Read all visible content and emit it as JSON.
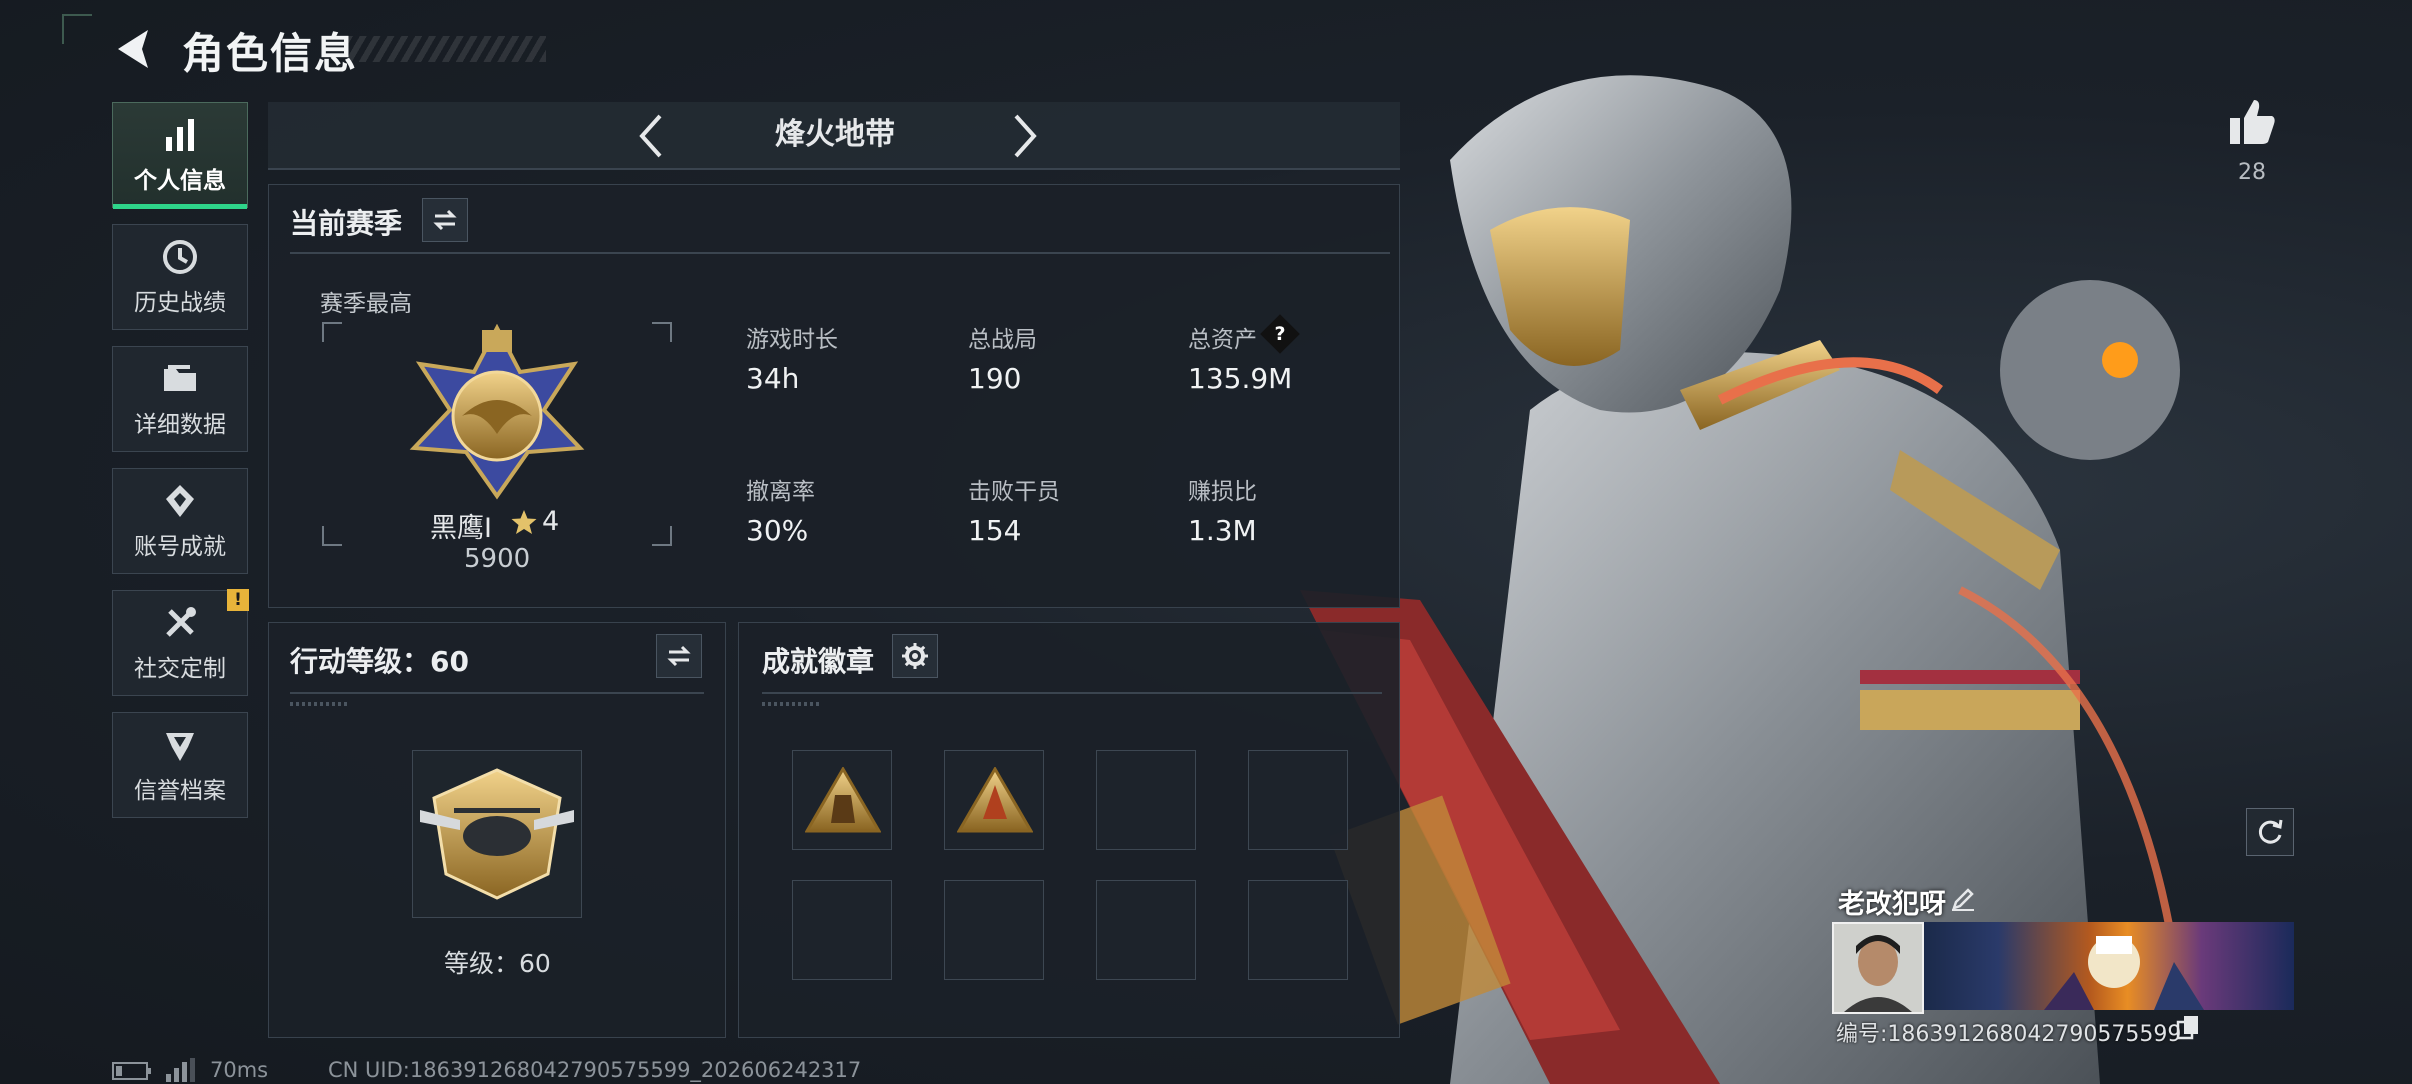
{
  "header": {
    "title": "角色信息"
  },
  "sidebar": {
    "items": [
      {
        "label": "个人信息",
        "icon": "bar-chart-icon",
        "active": true
      },
      {
        "label": "历史战绩",
        "icon": "history-clock-icon",
        "active": false
      },
      {
        "label": "详细数据",
        "icon": "folder-icon",
        "active": false
      },
      {
        "label": "账号成就",
        "icon": "achievement-icon",
        "active": false
      },
      {
        "label": "社交定制",
        "icon": "tools-icon",
        "active": false,
        "alert": "!"
      },
      {
        "label": "信誉档案",
        "icon": "reputation-icon",
        "active": false
      }
    ]
  },
  "mode": {
    "label": "烽火地带"
  },
  "season": {
    "title": "当前赛季",
    "best_label": "赛季最高",
    "rank_name": "黑鹰I",
    "rank_stars": "4",
    "rank_score": "5900",
    "stats": [
      {
        "label": "游戏时长",
        "value": "34h"
      },
      {
        "label": "总战局",
        "value": "190"
      },
      {
        "label": "总资产",
        "value": "135.9M",
        "help": "?"
      },
      {
        "label": "撤离率",
        "value": "30%"
      },
      {
        "label": "击败干员",
        "value": "154"
      },
      {
        "label": "赚损比",
        "value": "1.3M"
      }
    ]
  },
  "action_level": {
    "title": "行动等级：60",
    "level_text": "等级：60"
  },
  "achievements": {
    "title": "成就徽章",
    "filled_slots": 2,
    "total_slots": 8
  },
  "likes": {
    "count": "28"
  },
  "player": {
    "name": "老改犯呀",
    "id_text": "编号:186391268042790575599"
  },
  "footer": {
    "ping": "70ms",
    "uid": "CN UID:186391268042790575599_202606242317"
  },
  "colors": {
    "accent": "#2ed58a",
    "alert": "#e8b43a",
    "panel": "#1b2128"
  }
}
